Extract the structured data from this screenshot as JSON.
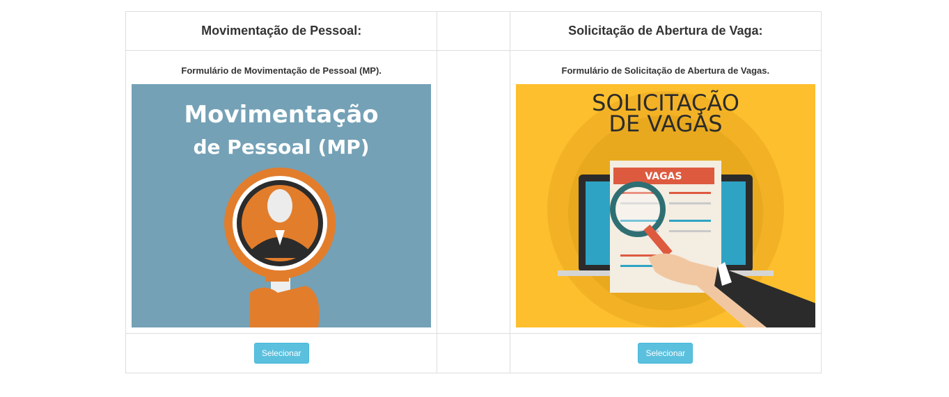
{
  "cards": [
    {
      "heading": "Movimentação de Pessoal:",
      "description": "Formulário de Movimentação de Pessoal (MP).",
      "image_text_line1": "Movimentação",
      "image_text_line2": "de Pessoal (MP)",
      "button_label": "Selecionar"
    },
    {
      "heading": "Solicitação de Abertura de Vaga:",
      "description": "Formulário de Solicitação de Abertura de Vagas.",
      "image_text_line1": "SOLICITAÇÃO",
      "image_text_line2": "DE VAGAS",
      "image_badge": "VAGAS",
      "button_label": "Selecionar"
    }
  ],
  "colors": {
    "mp_background": "#74a1b6",
    "vagas_background": "#fdbf2d",
    "button": "#5bc0de",
    "border": "#dddddd"
  }
}
